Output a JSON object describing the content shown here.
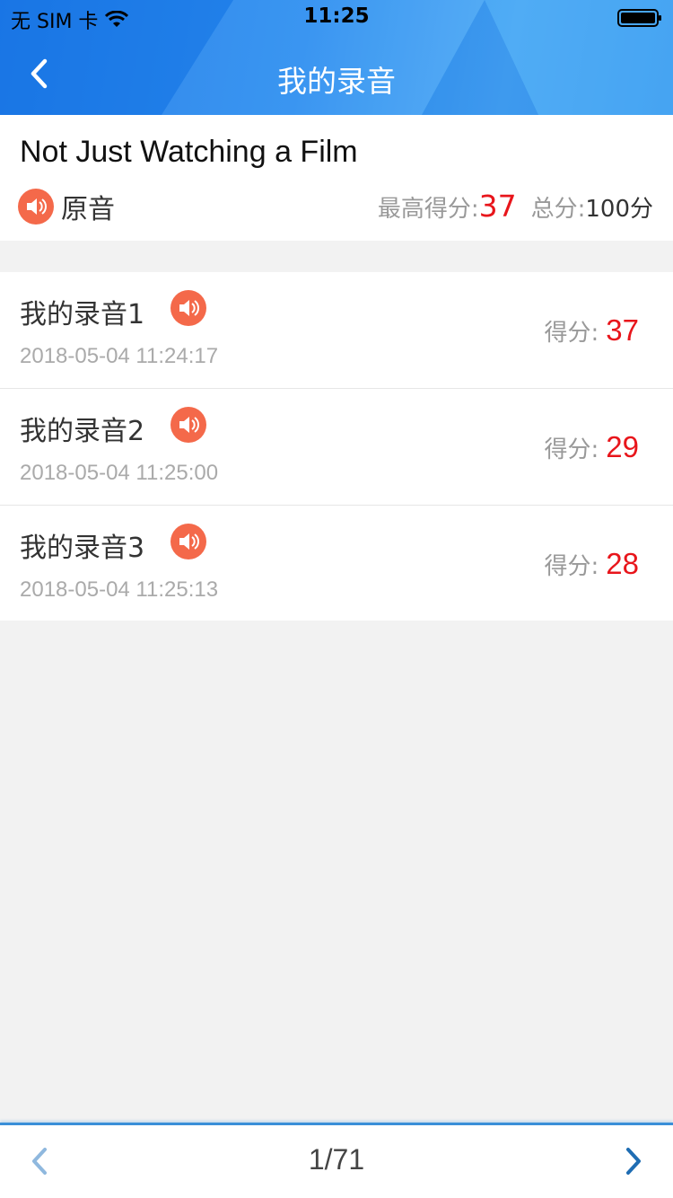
{
  "status_bar": {
    "carrier": "无 SIM 卡",
    "time": "11:25"
  },
  "nav": {
    "title": "我的录音",
    "back_icon": "chevron-left-icon"
  },
  "summary": {
    "title": "Not Just Watching a Film",
    "original_label": "原音",
    "best_score_label": "最高得分:",
    "best_score": "37",
    "total_label": "总分:",
    "total_value": "100分"
  },
  "recordings": [
    {
      "name": "我的录音1",
      "date": "2018-05-04 11:24:17",
      "score_label": "得分:",
      "score": "37"
    },
    {
      "name": "我的录音2",
      "date": "2018-05-04 11:25:00",
      "score_label": "得分:",
      "score": "29"
    },
    {
      "name": "我的录音3",
      "date": "2018-05-04 11:25:13",
      "score_label": "得分:",
      "score": "28"
    }
  ],
  "pager": {
    "count": "1/71",
    "prev_icon": "chevron-left-icon",
    "next_icon": "chevron-right-icon"
  },
  "colors": {
    "header_blue": "#2a8df0",
    "score_red": "#e8151b",
    "speaker_orange": "#f4694a",
    "pager_blue": "#3a8fd8"
  }
}
